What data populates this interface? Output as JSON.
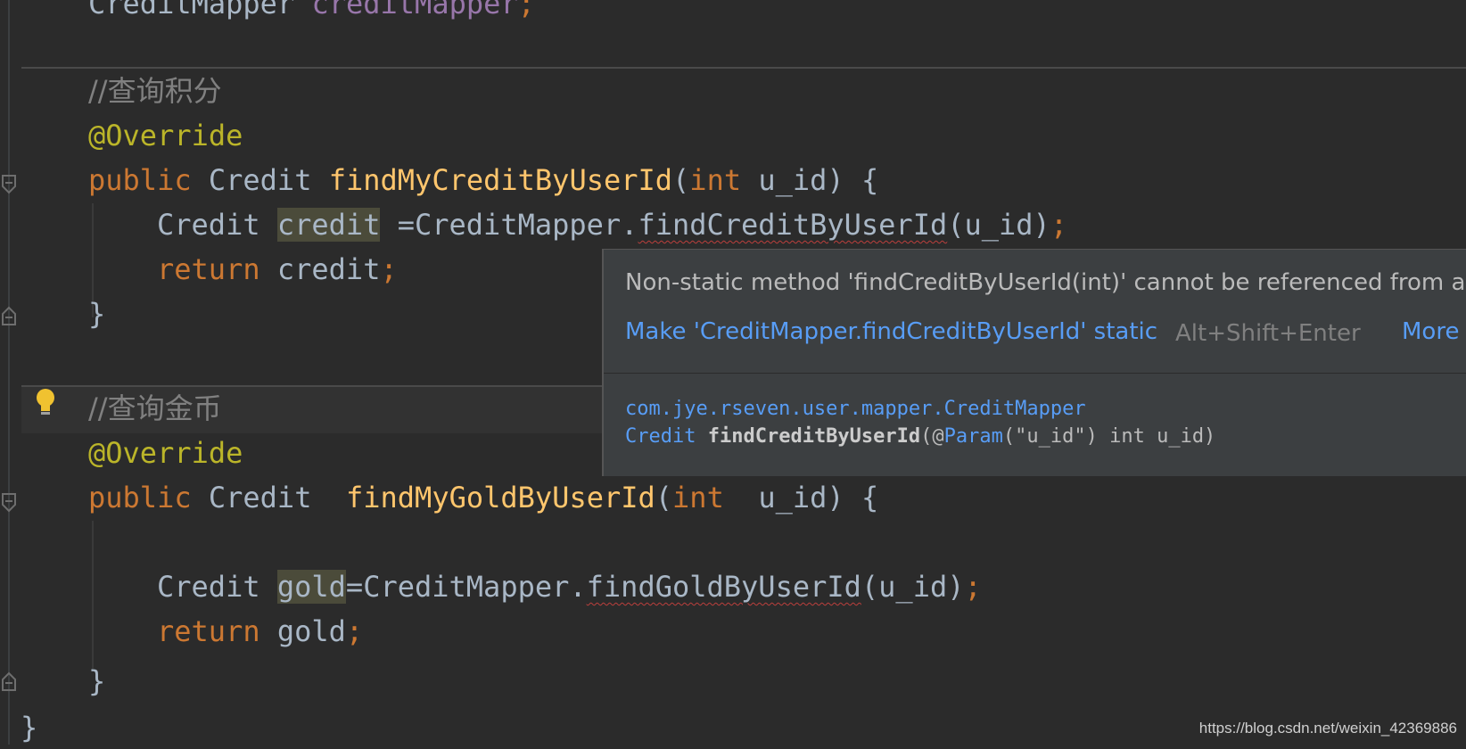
{
  "editor": {
    "lines": {
      "l0_type": "CreditMapper",
      "l0_field": "creditMapper",
      "l0_semi": ";",
      "comment1": "//查询积分",
      "override1": "@Override",
      "public1": "public",
      "type1": "Credit",
      "method1": "findMyCreditByUserId",
      "paren_open1": "(",
      "int1": "int",
      "param1": "u_id) {",
      "stmt1_type": "Credit",
      "stmt1_var": "credit",
      "stmt1_rest_a": " =CreditMapper.",
      "stmt1_call": "findCreditByUserId",
      "stmt1_rest_b": "(u_id)",
      "stmt1_semi": ";",
      "return1_kw": "return",
      "return1_val": " credit",
      "return1_semi": ";",
      "close1": "}",
      "comment2": "//查询金币",
      "override2": "@Override",
      "public2": "public",
      "type2": "Credit",
      "method2": "findMyGoldByUserId",
      "paren_open2": "(",
      "int2": "int",
      "param2": "  u_id) {",
      "stmt2_type": "Credit",
      "stmt2_var": "gold",
      "stmt2_rest_a": "=CreditMapper.",
      "stmt2_call": "findGoldByUserId",
      "stmt2_rest_b": "(u_id)",
      "stmt2_semi": ";",
      "return2_kw": "return",
      "return2_val": " gold",
      "return2_semi": ";",
      "close2": "}",
      "class_close": "}"
    }
  },
  "popup": {
    "message": "Non-static method 'findCreditByUserId(int)' cannot be referenced from a s",
    "quickfix": "Make 'CreditMapper.findCreditByUserId' static",
    "shortcut": "Alt+Shift+Enter",
    "more": "More",
    "doc_package": "com.jye.rseven.user.mapper.CreditMapper",
    "doc_sig_type": "Credit",
    "doc_sig_method": "findCreditByUserId",
    "doc_sig_paren": "(@",
    "doc_sig_annotation": "Param",
    "doc_sig_rest": "(\"u_id\") int u_id)"
  },
  "watermark": "https://blog.csdn.net/weixin_42369886",
  "colors": {
    "background": "#2b2b2b",
    "keyword": "#cc7832",
    "annotation": "#bbb529",
    "function": "#ffc66d",
    "comment": "#808080",
    "field": "#9876aa",
    "link": "#589df6",
    "text": "#a9b7c6"
  }
}
